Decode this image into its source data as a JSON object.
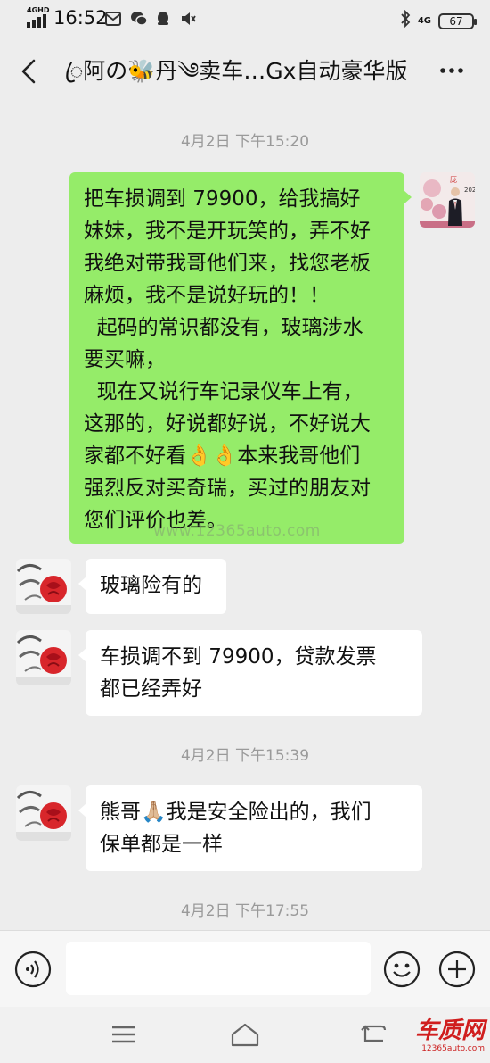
{
  "status_bar": {
    "network": "4GHD",
    "time": "16:52",
    "mobile_network": "4G",
    "battery": "67"
  },
  "header": {
    "title": "ꦿ阿の🐝丹༄卖车…Gx自动豪华版"
  },
  "messages": [
    {
      "type": "time",
      "text": "4月2日 下午15:20"
    },
    {
      "type": "outgoing",
      "text": "把车损调到 79900，给我搞好\n妹妹，我不是开玩笑的，弄不好\n我绝对带我哥他们来，找您老板\n麻烦，我不是说好玩的！！\n  起码的常识都没有，玻璃涉水\n要买嘛，\n  现在又说行车记录仪车上有，\n这那的，好说都好说，不好说大\n家都不好看👌👌本来我哥他们\n强烈反对买奇瑞，买过的朋友对\n您们评价也差。"
    },
    {
      "type": "incoming",
      "text": "玻璃险有的"
    },
    {
      "type": "incoming",
      "text": "车损调不到 79900，贷款发票\n都已经弄好"
    },
    {
      "type": "time",
      "text": "4月2日 下午15:39"
    },
    {
      "type": "incoming",
      "text": "熊哥🙏🏼我是安全险出的，我们\n保单都是一样"
    },
    {
      "type": "time",
      "text": "4月2日 下午17:55"
    }
  ],
  "input": {
    "placeholder": ""
  },
  "watermark": {
    "center": "www.12365auto.com",
    "logo_big": "车质网",
    "logo_small": "12365auto.com"
  },
  "colors": {
    "outgoing_bubble": "#95ec69",
    "incoming_bubble": "#ffffff",
    "background": "#ededed"
  }
}
